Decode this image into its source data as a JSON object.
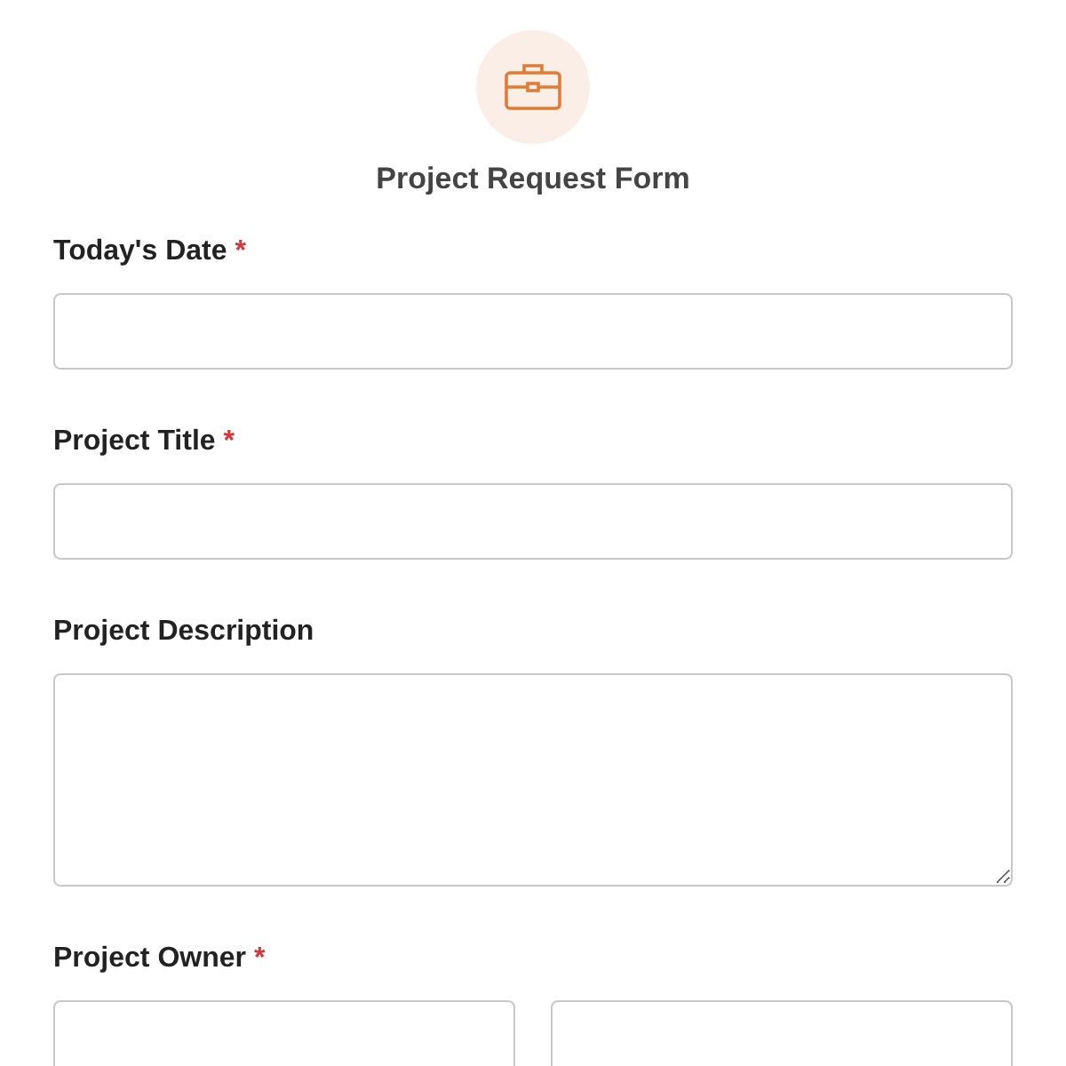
{
  "form": {
    "title": "Project Request Form"
  },
  "fields": [
    {
      "label": "Today's Date",
      "required_mark": "*",
      "kind": "text"
    },
    {
      "label": "Project Title",
      "required_mark": "*",
      "kind": "text"
    },
    {
      "label": "Project Description",
      "kind": "textarea"
    },
    {
      "label": "Project Owner",
      "required_mark": "*",
      "kind": "split"
    }
  ]
}
